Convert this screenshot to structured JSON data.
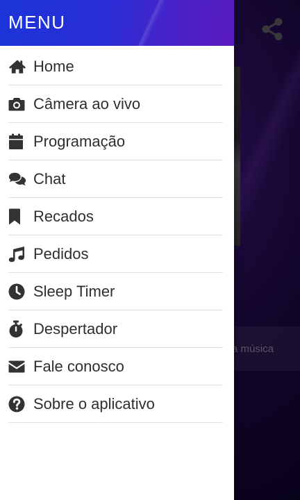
{
  "drawer": {
    "title": "MENU",
    "items": [
      {
        "label": "Home",
        "icon": "home-icon"
      },
      {
        "label": "Câmera ao vivo",
        "icon": "camera-icon"
      },
      {
        "label": "Programação",
        "icon": "calendar-icon"
      },
      {
        "label": "Chat",
        "icon": "chat-icon"
      },
      {
        "label": "Recados",
        "icon": "bookmark-icon"
      },
      {
        "label": "Pedidos",
        "icon": "music-icon"
      },
      {
        "label": "Sleep Timer",
        "icon": "clock-icon"
      },
      {
        "label": "Despertador",
        "icon": "stopwatch-icon"
      },
      {
        "label": "Fale conosco",
        "icon": "envelope-icon"
      },
      {
        "label": "Sobre o aplicativo",
        "icon": "question-circle-icon"
      }
    ]
  },
  "background": {
    "song_text": "a música",
    "share_icon": "share-icon"
  },
  "colors": {
    "header_gradient_start": "#1a34d8",
    "header_gradient_end": "#5a1cc0",
    "icon_color": "#333333",
    "text_color": "#2e2e2e"
  }
}
